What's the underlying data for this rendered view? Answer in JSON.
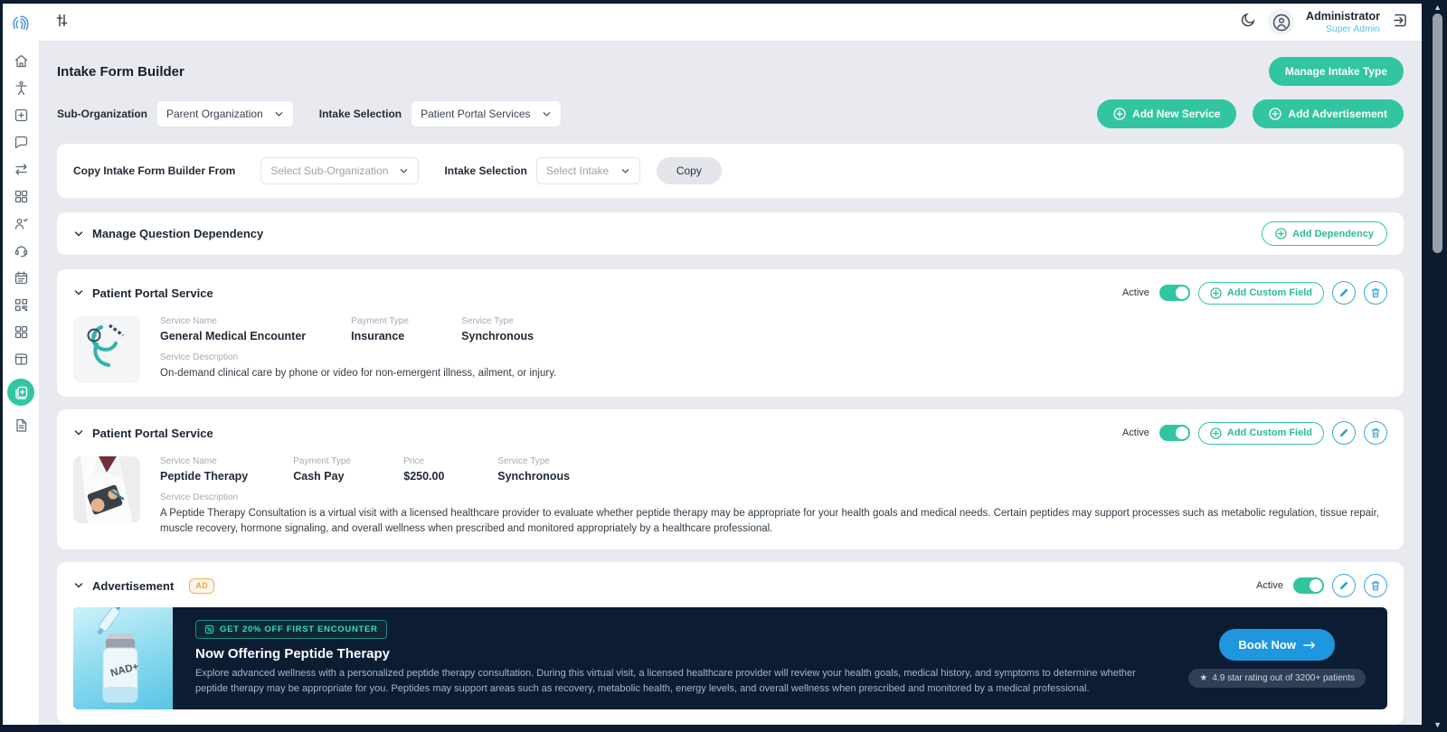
{
  "header": {
    "user_name": "Administrator",
    "user_role": "Super Admin",
    "icons": [
      "filter-sliders",
      "dark-mode-moon",
      "user-avatar",
      "logout"
    ]
  },
  "sidebar": {
    "logo": "fingerprint-logo",
    "items": [
      "home",
      "accessibility",
      "add-square",
      "chat",
      "transfers",
      "apps-grid",
      "patients",
      "support",
      "appointments",
      "qr-code",
      "modules-grid",
      "tables",
      "form-builder",
      "documents"
    ],
    "active_item": "form-builder"
  },
  "page": {
    "title": "Intake Form Builder",
    "manage_intake_type": "Manage Intake Type",
    "add_new_service": "Add New Service",
    "add_advertisement": "Add Advertisement"
  },
  "filters": {
    "sub_org_label": "Sub-Organization",
    "sub_org_value": "Parent Organization",
    "intake_label": "Intake Selection",
    "intake_value": "Patient Portal Services"
  },
  "copy_section": {
    "label": "Copy Intake Form Builder From",
    "sub_org_placeholder": "Select Sub-Organization",
    "intake_label": "Intake Selection",
    "intake_placeholder": "Select Intake",
    "copy_button": "Copy"
  },
  "dependency": {
    "title": "Manage Question Dependency",
    "add_button": "Add Dependency"
  },
  "service_common": {
    "active_label": "Active",
    "add_custom_field": "Add Custom Field",
    "description_label": "Service Description"
  },
  "services": [
    {
      "title": "Patient Portal Service",
      "image": "stethoscope-photo",
      "fields": [
        {
          "label": "Service Name",
          "value": "General Medical Encounter"
        },
        {
          "label": "Payment Type",
          "value": "Insurance"
        },
        {
          "label": "Service Type",
          "value": "Synchronous"
        }
      ],
      "description": "On-demand clinical care by phone or video for non-emergent illness, ailment, or injury."
    },
    {
      "title": "Patient Portal Service",
      "image": "doctor-photo",
      "fields": [
        {
          "label": "Service Name",
          "value": "Peptide Therapy"
        },
        {
          "label": "Payment Type",
          "value": "Cash Pay"
        },
        {
          "label": "Price",
          "value": "$250.00"
        },
        {
          "label": "Service Type",
          "value": "Synchronous"
        }
      ],
      "description": "A Peptide Therapy Consultation is a virtual visit with a licensed healthcare provider to evaluate whether peptide therapy may be appropriate for your health goals and medical needs. Certain peptides may support processes such as metabolic regulation, tissue repair, muscle recovery, hormone signaling, and overall wellness when prescribed and monitored appropriately by a healthcare professional."
    }
  ],
  "advertisement": {
    "title": "Advertisement",
    "badge": "AD",
    "active_label": "Active",
    "banner": {
      "offer_badge": "GET 20% OFF FIRST ENCOUNTER",
      "headline": "Now Offering Peptide Therapy",
      "description": "Explore advanced wellness with a personalized peptide therapy consultation. During this virtual visit, a licensed healthcare provider will review your health goals, medical history, and symptoms to determine whether peptide therapy may be appropriate for you. Peptides may support areas such as recovery, metabolic health, energy levels, and overall wellness when prescribed and monitored by a medical professional.",
      "book_button": "Book Now",
      "rating": "4.9 star rating out of 3200+ patients",
      "vial_label": "NAD+"
    }
  },
  "colors": {
    "accent_green": "#31c5a1",
    "accent_blue": "#2d9fd9",
    "book_blue": "#1e97de",
    "dark_navy": "#0c1c33",
    "badge_orange": "#eda43c",
    "role_blue": "#54c0ea"
  }
}
